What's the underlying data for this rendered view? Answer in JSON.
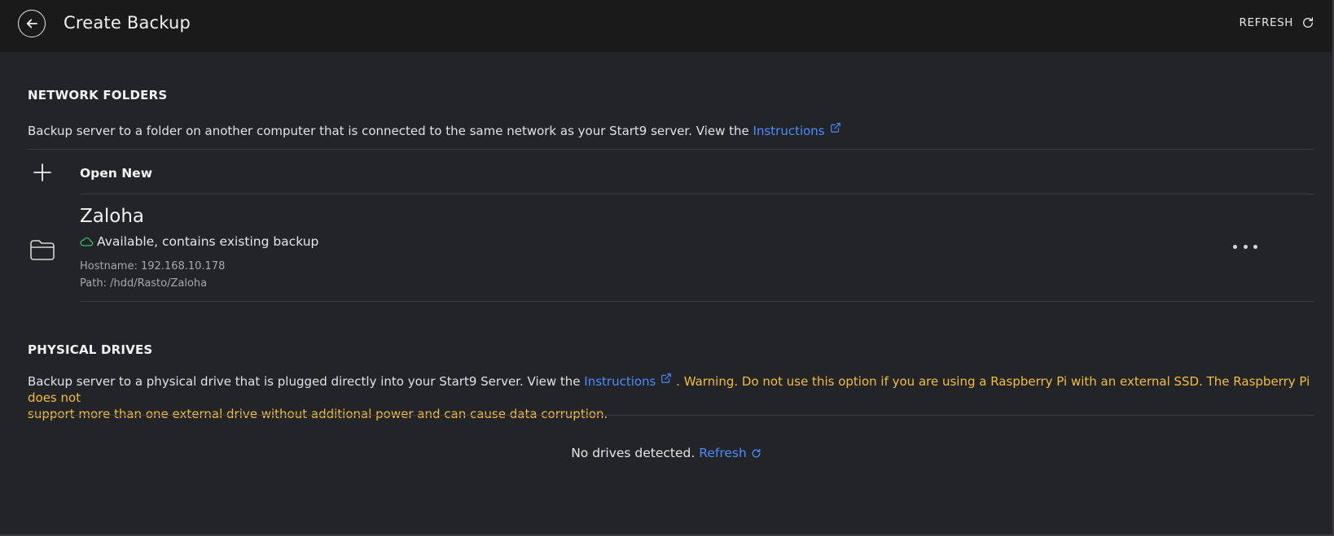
{
  "header": {
    "title": "Create Backup",
    "refresh_label": "REFRESH"
  },
  "network_folders": {
    "title": "NETWORK FOLDERS",
    "desc_prefix": "Backup server to a folder on another computer that is connected to the same network as your Start9 server. View the",
    "instructions_link": "Instructions",
    "open_new_label": "Open New",
    "folders": [
      {
        "name": "Zaloha",
        "status": "Available, contains existing backup",
        "hostname": "Hostname: 192.168.10.178",
        "path": "Path: /hdd/Rasto/Zaloha"
      }
    ]
  },
  "physical_drives": {
    "title": "PHYSICAL DRIVES",
    "desc_prefix": "Backup server to a physical drive that is plugged directly into your Start9 Server. View the",
    "instructions_link": "Instructions",
    "warning_line1": ". Warning. Do not use this option if you are using a Raspberry Pi with an external SSD. The Raspberry Pi does not",
    "warning_line2": "support more than one external drive without additional power and can cause data corruption.",
    "empty_text": "No drives detected.",
    "refresh_link": "Refresh"
  },
  "colors": {
    "background": "#222428",
    "header": "#1a1a1a",
    "link": "#4a8cff",
    "warning": "#f4be3c",
    "success": "#2fbf71"
  },
  "icons": {
    "back": "arrow-left-icon",
    "refresh": "refresh-icon",
    "external": "external-link-icon",
    "plus": "plus-icon",
    "folder": "folder-open-icon",
    "cloud": "cloud-icon",
    "more": "more-horizontal-icon"
  }
}
